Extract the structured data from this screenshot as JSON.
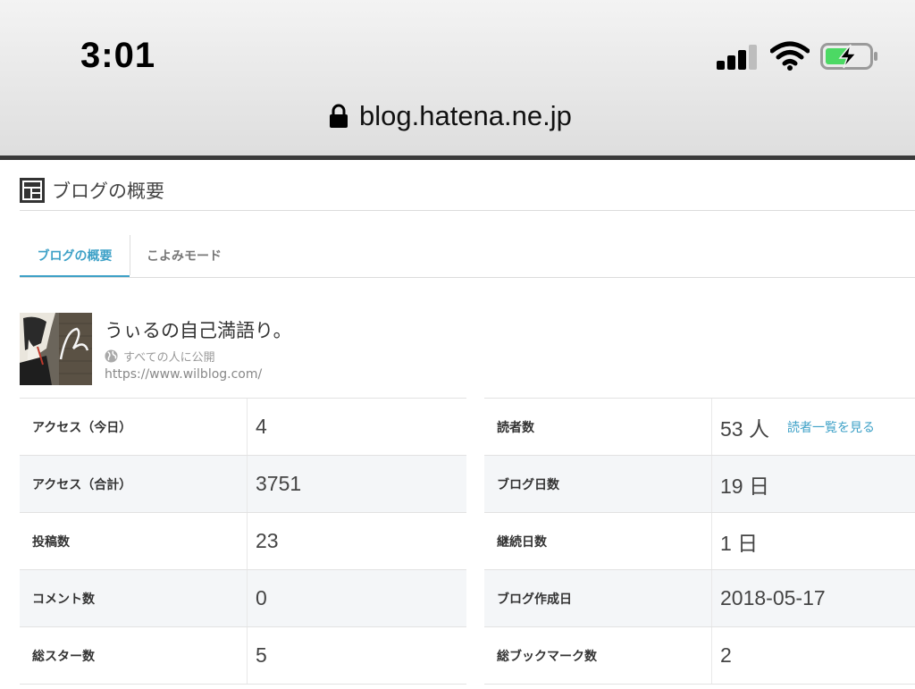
{
  "status_bar": {
    "time": "3:01",
    "icons": [
      "signal-icon",
      "wifi-icon",
      "battery-charging-icon"
    ]
  },
  "browser": {
    "url": "blog.hatena.ne.jp",
    "icon": "lock-icon"
  },
  "section": {
    "title": "ブログの概要",
    "icon": "dashboard-icon"
  },
  "tabs": [
    {
      "label": "ブログの概要",
      "active": true
    },
    {
      "label": "こよみモード",
      "active": false
    }
  ],
  "profile": {
    "blog_name": "うぃるの自己満語り。",
    "visibility": "すべての人に公開",
    "url": "https://www.wilblog.com/"
  },
  "stats_left": [
    {
      "label": "アクセス（今日）",
      "value": "4"
    },
    {
      "label": "アクセス（合計）",
      "value": "3751"
    },
    {
      "label": "投稿数",
      "value": "23"
    },
    {
      "label": "コメント数",
      "value": "0"
    },
    {
      "label": "総スター数",
      "value": "5"
    }
  ],
  "stats_right": [
    {
      "label": "読者数",
      "value": "53 人",
      "link": "読者一覧を見る"
    },
    {
      "label": "ブログ日数",
      "value": "19 日"
    },
    {
      "label": "継続日数",
      "value": "1 日"
    },
    {
      "label": "ブログ作成日",
      "value": "2018-05-17"
    },
    {
      "label": "総ブックマーク数",
      "value": "2"
    }
  ],
  "colors": {
    "accent": "#3ea1c7",
    "row_alt": "#f4f6f8",
    "border": "#e2e2e2"
  }
}
